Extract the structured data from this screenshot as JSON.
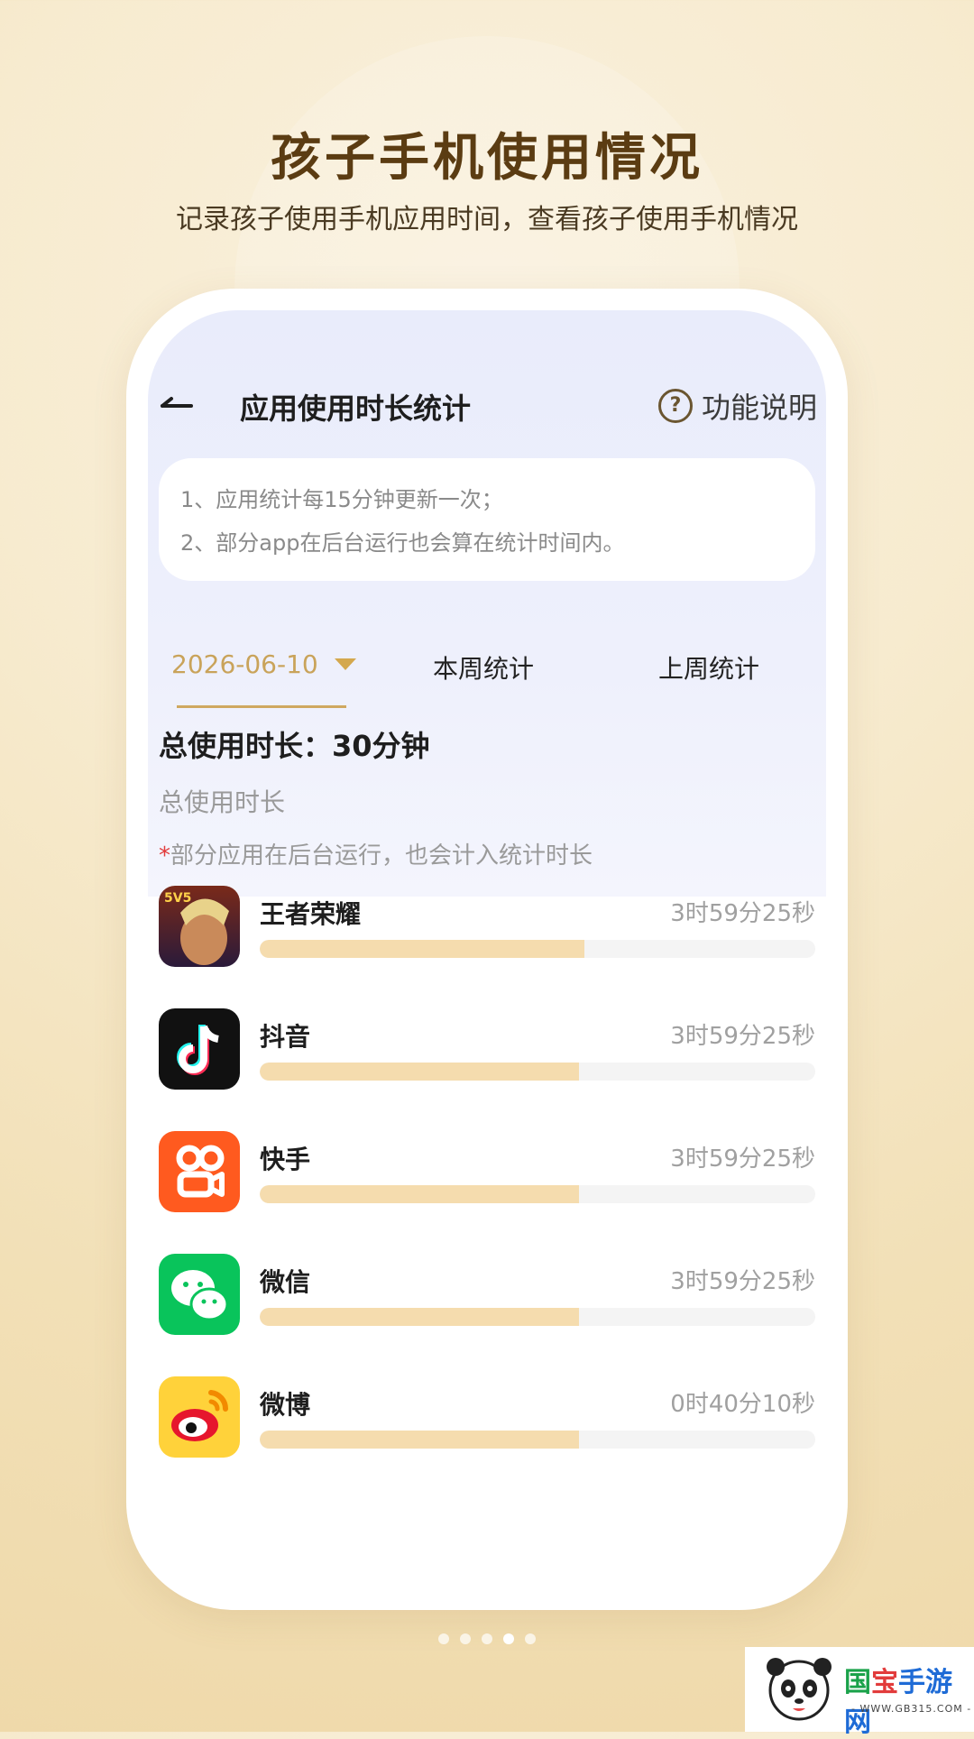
{
  "hero": {
    "title": "孩子手机使用情况",
    "subtitle": "记录孩子使用手机应用时间，查看孩子使用手机情况"
  },
  "app_screen": {
    "title": "应用使用时长统计",
    "help_label": "功能说明",
    "notices": [
      "1、应用统计每15分钟更新一次；",
      "2、部分app在后台运行也会算在统计时间内。"
    ],
    "tabs": {
      "date": "2026-06-10",
      "this_week": "本周统计",
      "last_week": "上周统计"
    },
    "total_usage": "总使用时长：30分钟",
    "total_sub": "总使用时长",
    "note_star": "*",
    "note_text": "部分应用在后台运行，也会计入统计时长",
    "apps": [
      {
        "name": "王者荣耀",
        "time": "3时59分25秒",
        "fill": 0.585,
        "icon": "honor-of-kings-icon"
      },
      {
        "name": "抖音",
        "time": "3时59分25秒",
        "fill": 0.575,
        "icon": "douyin-icon"
      },
      {
        "name": "快手",
        "time": "3时59分25秒",
        "fill": 0.575,
        "icon": "kuaishou-icon"
      },
      {
        "name": "微信",
        "time": "3时59分25秒",
        "fill": 0.575,
        "icon": "wechat-icon"
      },
      {
        "name": "微博",
        "time": "0时40分10秒",
        "fill": 0.575,
        "icon": "weibo-icon"
      }
    ]
  },
  "carousel": {
    "count": 5,
    "active": 3
  },
  "watermark": {
    "title_1": "国",
    "title_2": "宝",
    "title_3": "手游网",
    "url": "- WWW.GB315.COM -"
  },
  "colors": {
    "accent": "#c9a35a",
    "bar_fill": "#f5dcae",
    "bar_track": "#f4f4f4",
    "brand_title": "#5b3c12"
  }
}
